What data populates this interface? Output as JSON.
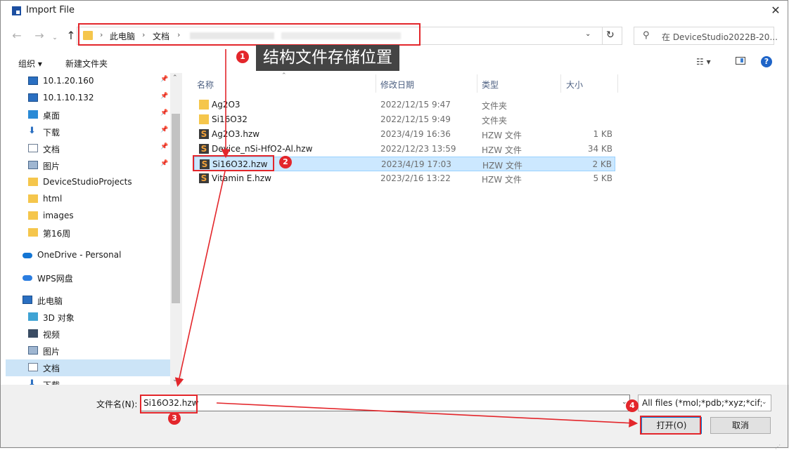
{
  "window": {
    "title": "Import File",
    "close_label": "✕"
  },
  "address": {
    "crumbs": [
      "此电脑",
      "文档"
    ],
    "separator": "›",
    "search_placeholder": "在 DeviceStudio2022B-20..."
  },
  "toolbar": {
    "organize": "组织 ▾",
    "new_folder": "新建文件夹",
    "view": "☷ ▾",
    "help": "?"
  },
  "sidebar": {
    "items": [
      {
        "label": "10.1.20.160",
        "icon": "monitor-icon",
        "pinned": true
      },
      {
        "label": "10.1.10.132",
        "icon": "monitor-icon",
        "pinned": true
      },
      {
        "label": "桌面",
        "icon": "desktop-icon",
        "pinned": true
      },
      {
        "label": "下载",
        "icon": "download-icon",
        "pinned": true
      },
      {
        "label": "文档",
        "icon": "document-icon",
        "pinned": true
      },
      {
        "label": "图片",
        "icon": "picture-icon",
        "pinned": true
      },
      {
        "label": "DeviceStudioProjects",
        "icon": "folder-icon",
        "pinned": false
      },
      {
        "label": "html",
        "icon": "folder-icon",
        "pinned": false
      },
      {
        "label": "images",
        "icon": "folder-icon",
        "pinned": false
      },
      {
        "label": "第16周",
        "icon": "folder-icon",
        "pinned": false
      },
      {
        "label": "OneDrive - Personal",
        "icon": "onedrive-icon",
        "pinned": false
      },
      {
        "label": "WPS网盘",
        "icon": "wps-cloud-icon",
        "pinned": false
      },
      {
        "label": "此电脑",
        "icon": "computer-icon",
        "pinned": false
      },
      {
        "label": "3D 对象",
        "icon": "3d-objects-icon",
        "pinned": false
      },
      {
        "label": "视频",
        "icon": "video-icon",
        "pinned": false
      },
      {
        "label": "图片",
        "icon": "picture-icon",
        "pinned": false
      },
      {
        "label": "文档",
        "icon": "document-icon",
        "pinned": false,
        "selected": true
      },
      {
        "label": "下载",
        "icon": "download-icon",
        "pinned": false
      }
    ]
  },
  "columns": {
    "name": "名称",
    "modified": "修改日期",
    "type": "类型",
    "size": "大小"
  },
  "files": [
    {
      "name": "Ag2O3",
      "modified": "2022/12/15 9:47",
      "type": "文件夹",
      "size": "",
      "kind": "folder"
    },
    {
      "name": "Si16O32",
      "modified": "2022/12/15 9:49",
      "type": "文件夹",
      "size": "",
      "kind": "folder"
    },
    {
      "name": "Ag2O3.hzw",
      "modified": "2023/4/19 16:36",
      "type": "HZW 文件",
      "size": "1 KB",
      "kind": "hzw"
    },
    {
      "name": "Device_nSi-HfO2-Al.hzw",
      "modified": "2022/12/23 13:59",
      "type": "HZW 文件",
      "size": "34 KB",
      "kind": "hzw"
    },
    {
      "name": "Si16O32.hzw",
      "modified": "2023/4/19 17:03",
      "type": "HZW 文件",
      "size": "2 KB",
      "kind": "hzw",
      "selected": true
    },
    {
      "name": "Vitamin E.hzw",
      "modified": "2023/2/16 13:22",
      "type": "HZW 文件",
      "size": "5 KB",
      "kind": "hzw"
    }
  ],
  "bottom": {
    "filename_label": "文件名(N):",
    "filename_value": "Si16O32.hzw",
    "filter": "All files  (*mol;*pdb;*xyz;*cif;*",
    "open": "打开(O)",
    "cancel": "取消"
  },
  "annotations": {
    "callout": "结构文件存储位置",
    "badges": [
      "1",
      "2",
      "3",
      "4"
    ],
    "color": "#e3262b"
  }
}
